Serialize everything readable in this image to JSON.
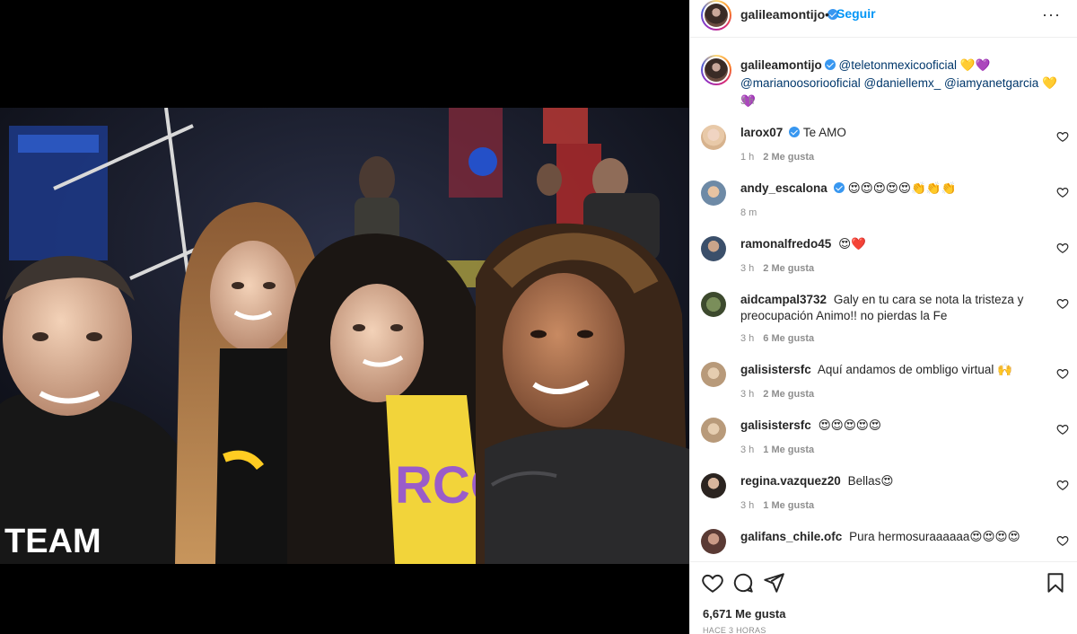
{
  "header": {
    "username": "galileamontijo",
    "separator": "•",
    "follow_label": "Seguir",
    "more_label": "···"
  },
  "caption": {
    "username": "galileamontijo",
    "line1_mention": "@teletonmexicooficial",
    "line1_emoji": "💛💜",
    "line2_mention_a": "@marianoosoriooficial",
    "line2_mention_b": "@daniellemx_",
    "line2_mention_c": "@iamyanetgarcia",
    "line2_emoji": "💛💜",
    "time": "3 h"
  },
  "comments": [
    {
      "user": "larox07",
      "verified": true,
      "text": "Te AMO",
      "time": "1 h",
      "likes": "2 Me gusta"
    },
    {
      "user": "andy_escalona",
      "verified": true,
      "text": "😍😍😍😍😍👏👏👏",
      "time": "8 m",
      "likes": ""
    },
    {
      "user": "ramonalfredo45",
      "verified": false,
      "text": "😍❤️",
      "time": "3 h",
      "likes": "2 Me gusta"
    },
    {
      "user": "aidcampal3732",
      "verified": false,
      "text": "Galy en tu cara se nota la tristeza y preocupación Animo!! no pierdas la Fe",
      "time": "3 h",
      "likes": "6 Me gusta"
    },
    {
      "user": "galisistersfc",
      "verified": false,
      "text": "Aquí andamos de ombligo virtual 🙌",
      "time": "3 h",
      "likes": "2 Me gusta"
    },
    {
      "user": "galisistersfc",
      "verified": false,
      "text": "😍😍😍😍😍",
      "time": "3 h",
      "likes": "1 Me gusta"
    },
    {
      "user": "regina.vazquez20",
      "verified": false,
      "text": "Bellas😍",
      "time": "3 h",
      "likes": "1 Me gusta"
    },
    {
      "user": "galifans_chile.ofc",
      "verified": false,
      "text": "Pura hermosuraaaaaa😍😍😍😍",
      "time": "",
      "likes": ""
    }
  ],
  "actions": {
    "likes": "6,671 Me gusta",
    "timestamp": "HACE 3 HORAS"
  },
  "colors": {
    "link_blue": "#0095f6",
    "verified_blue": "#3897f0",
    "mention": "#00376b",
    "muted": "#8e8e8e"
  }
}
